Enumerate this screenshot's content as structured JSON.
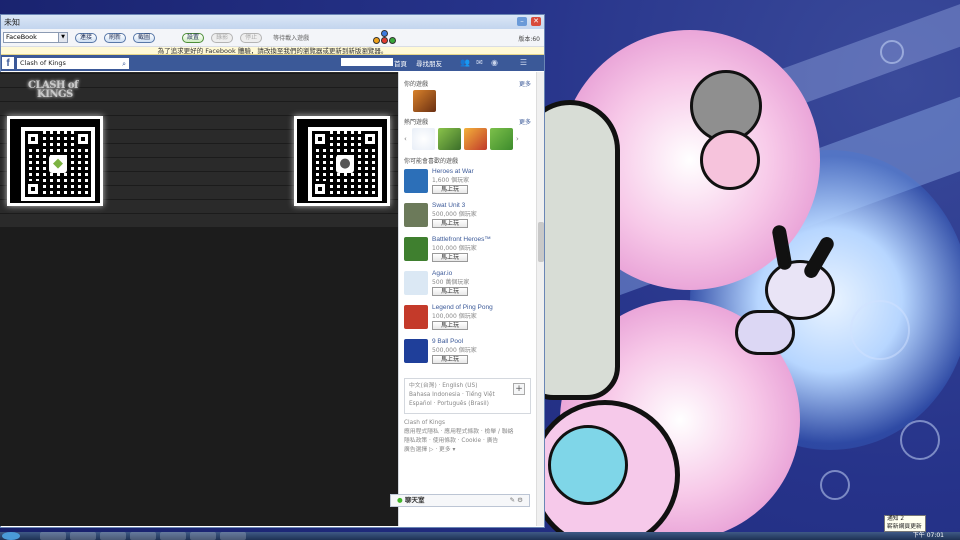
{
  "window": {
    "title": "未知",
    "min_glyph": "–",
    "close_glyph": "✕"
  },
  "toolbar": {
    "select_value": "FaceBook",
    "btn_connect": "連接",
    "btn_refresh": "刷新",
    "btn_screenshot": "截圖",
    "btn_settings": "設置",
    "btn_record": "錄影",
    "btn_stop": "停止",
    "status": "等待載入遊戲",
    "version": "版本:60"
  },
  "notice": "為了追求更好的 Facebook 體驗，請改換至我們的瀏覽器或更新到新版瀏覽器。",
  "fb": {
    "logo": "f",
    "search_value": "Clash of Kings",
    "home": "首頁",
    "find_friends": "尋找朋友"
  },
  "game": {
    "title_line1": "CLASH of",
    "title_line2": "KINGS",
    "android_icon": "android-icon",
    "apple_icon": "apple-icon"
  },
  "sidebar": {
    "your_games": "你的遊戲",
    "more": "更多",
    "recommended": "熱門遊戲",
    "suggested": "你可能會喜歡的遊戲",
    "play_label": "馬上玩",
    "games": [
      {
        "name": "Heroes at War",
        "count": "1,600 個玩家",
        "color": "#2c6fb8"
      },
      {
        "name": "Swat Unit 3",
        "count": "500,000 個玩家",
        "color": "#6c7a5a"
      },
      {
        "name": "Battlefront Heroes™",
        "count": "100,000 個玩家",
        "color": "#3f7f2f"
      },
      {
        "name": "Agar.io",
        "count": "500 萬個玩家",
        "color": "#dbe8f4"
      },
      {
        "name": "Legend of Ping Pong",
        "count": "100,000 個玩家",
        "color": "#c43a2a"
      },
      {
        "name": "9 Ball Pool",
        "count": "500,000 個玩家",
        "color": "#1f3f9a"
      }
    ],
    "lang_line1": "中文(台灣) · English (US)",
    "lang_line2": "Bahasa Indonesia · Tiếng Việt",
    "lang_line3": "Español · Português (Brasil)",
    "lang_plus": "+",
    "footer_line1": "Clash of Kings",
    "footer_line2": "應用程式隱私 · 應用程式條款 · 檢舉 / 聯絡",
    "footer_line3": "隱私政策 · 使用條款 · Cookie · 廣告",
    "footer_line4": "廣告選擇 ▷ · 更多 ▾"
  },
  "chat": {
    "dot": "●",
    "label": "聊天室",
    "icons": "✎ ⚙"
  },
  "taskbar": {
    "time": "下午 07:01"
  },
  "tooltip": {
    "line1": "通知 2",
    "line2": "嶄新網頁更新"
  }
}
